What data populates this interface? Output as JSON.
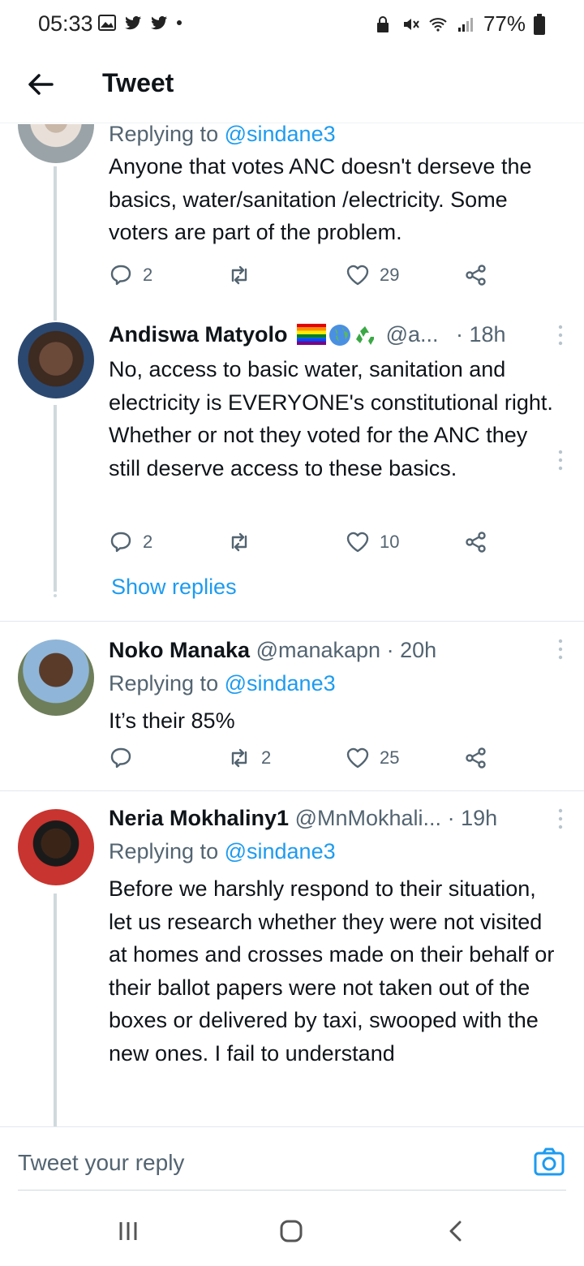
{
  "status_bar": {
    "time": "05:33",
    "battery": "77%"
  },
  "header": {
    "title": "Tweet"
  },
  "tweets": [
    {
      "name": "",
      "handle": "",
      "time": "",
      "replying_prefix": "Replying to ",
      "replying_to": "@sindane3",
      "body": "Anyone that votes ANC doesn't derseve the basics, water/sanitation /electricity. Some voters are part of the problem.",
      "replies": "2",
      "retweets": "",
      "likes": "29"
    },
    {
      "name": "Andiswa Matyolo",
      "handle": "@a...",
      "time": "· 18h",
      "body": "No, access to basic water, sanitation and electricity is EVERYONE's constitutional right. Whether or not they voted for the ANC they still deserve access to these basics.",
      "replies": "2",
      "retweets": "",
      "likes": "10",
      "show_replies": "Show replies"
    },
    {
      "name": "Noko Manaka",
      "handle": "@manakapn",
      "time": "· 20h",
      "replying_prefix": "Replying to ",
      "replying_to": "@sindane3",
      "body": "It’s their 85%",
      "replies": "",
      "retweets": "2",
      "likes": "25"
    },
    {
      "name": "Neria Mokhaliny1",
      "handle": "@MnMokhali...",
      "time": "· 19h",
      "replying_prefix": "Replying to ",
      "replying_to": "@sindane3",
      "body": "Before we harshly respond to their situation, let us research whether they were not visited at homes and crosses made on their behalf or their ballot papers were not taken out of the boxes or delivered by taxi, swooped with the new ones. I fail to understand"
    }
  ],
  "reply_bar": {
    "placeholder": "Tweet your reply"
  },
  "colors": {
    "accent": "#1d9bf0",
    "muted": "#536471",
    "text": "#0f1419"
  }
}
